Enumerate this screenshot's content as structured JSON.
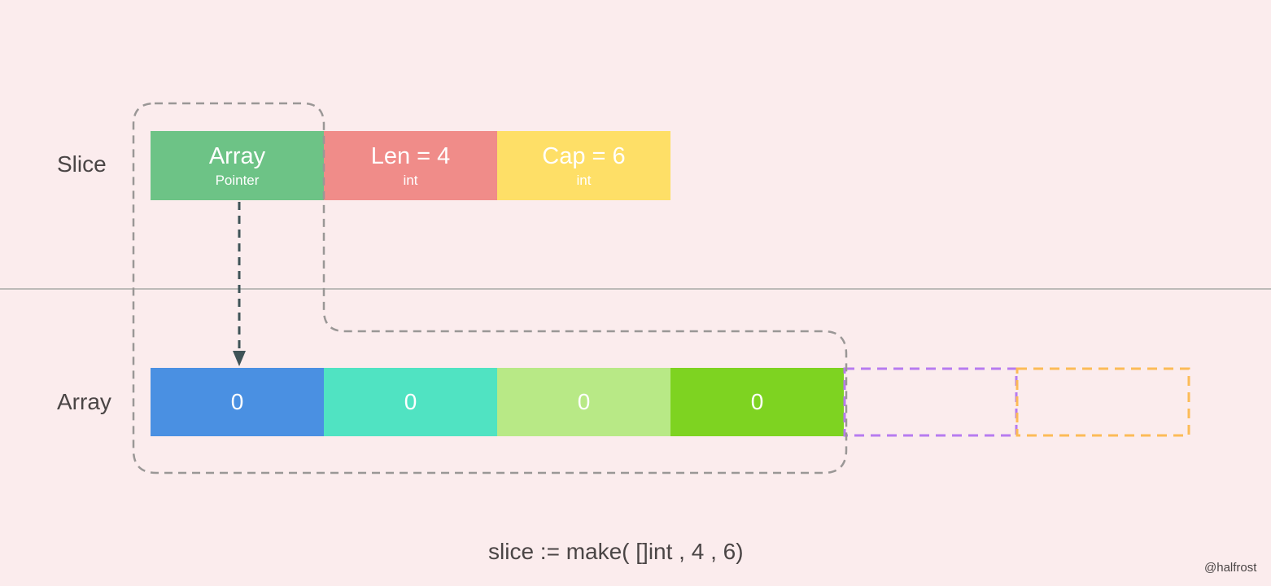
{
  "labels": {
    "slice_row": "Slice",
    "array_row": "Array"
  },
  "slice_header": [
    {
      "title": "Array",
      "subtitle": "Pointer",
      "color": "#6dc386"
    },
    {
      "title": "Len = 4",
      "subtitle": "int",
      "color": "#f08c89"
    },
    {
      "title": "Cap = 6",
      "subtitle": "int",
      "color": "#fedf67"
    }
  ],
  "array_cells": [
    {
      "value": "0",
      "color": "#4a90e2"
    },
    {
      "value": "0",
      "color": "#50e3c2"
    },
    {
      "value": "0",
      "color": "#b8e986"
    },
    {
      "value": "0",
      "color": "#7ed321"
    }
  ],
  "capacity_slots": [
    {
      "color": "#b77bf0"
    },
    {
      "color": "#fcbb57"
    }
  ],
  "code": "slice := make( []int , 4 , 6)",
  "credit": "@halfrost",
  "colors": {
    "background": "#fbeced",
    "divider": "#bdbab8",
    "dashed_outline": "#9a9796",
    "pointer_arrow": "#3f5357"
  }
}
